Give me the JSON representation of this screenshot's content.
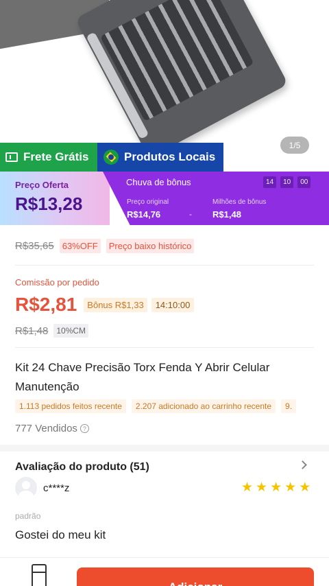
{
  "gallery": {
    "pager": "1/5"
  },
  "badges": {
    "free_shipping": "Frete Grátis",
    "local_products": "Produtos Locais"
  },
  "price_banner": {
    "offer_label": "Preço Oferta",
    "offer_price": "R$13,28",
    "event_label": "Chuva de bônus",
    "countdown": [
      "14",
      "10",
      "00"
    ],
    "original_label": "Preço original",
    "original_value": "R$14,76",
    "minus": "-",
    "bonus_label": "Milhões de bônus",
    "bonus_value": "R$1,48"
  },
  "pricing": {
    "old_price": "R$35,65",
    "discount": "63%OFF",
    "historic_tag": "Preço baixo histórico"
  },
  "commission": {
    "label": "Comissão por pedido",
    "value": "R$2,81",
    "bonus": "Bônus R$1,33",
    "timer": "14:10:00",
    "old_value": "R$1,48",
    "rate": "10%CM"
  },
  "product": {
    "title": "Kit 24 Chave Precisão Torx Fenda Y Abrir Celular Manutenção",
    "chips": [
      "1.113 pedidos feitos recente",
      "2.207 adicionado ao carrinho recente",
      "9."
    ],
    "sold": "777 Vendidos",
    "info_icon": "?"
  },
  "review": {
    "title": "Avaliação do produto (51)",
    "username": "c****z",
    "stars": [
      "★",
      "★",
      "★",
      "★",
      "★"
    ],
    "rating": 5,
    "variant": "padrão",
    "comment": "Gostei do meu kit"
  },
  "bottom_bar": {
    "add_label": "Adicionar"
  },
  "colors": {
    "accent": "#ee4d2d",
    "purple": "#8e2de2",
    "green": "#1fa34a",
    "blue": "#1546a8",
    "star": "#f5c400"
  }
}
